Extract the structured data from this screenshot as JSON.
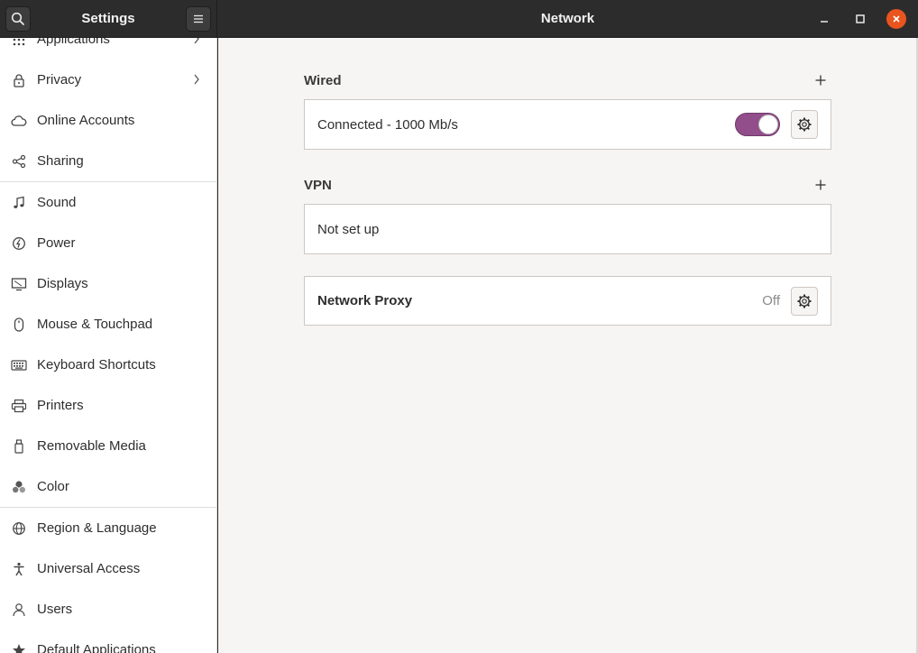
{
  "header": {
    "sidebar_title": "Settings",
    "page_title": "Network"
  },
  "sidebar": {
    "items": [
      {
        "label": "Applications",
        "icon": "apps-icon",
        "chevron": true
      },
      {
        "label": "Privacy",
        "icon": "lock-icon",
        "chevron": true
      },
      {
        "label": "Online Accounts",
        "icon": "cloud-icon"
      },
      {
        "label": "Sharing",
        "icon": "share-icon"
      },
      {
        "label": "Sound",
        "icon": "music-note-icon"
      },
      {
        "label": "Power",
        "icon": "power-icon"
      },
      {
        "label": "Displays",
        "icon": "display-icon"
      },
      {
        "label": "Mouse & Touchpad",
        "icon": "mouse-icon"
      },
      {
        "label": "Keyboard Shortcuts",
        "icon": "keyboard-icon"
      },
      {
        "label": "Printers",
        "icon": "printer-icon"
      },
      {
        "label": "Removable Media",
        "icon": "usb-icon"
      },
      {
        "label": "Color",
        "icon": "color-icon"
      },
      {
        "label": "Region & Language",
        "icon": "globe-icon"
      },
      {
        "label": "Universal Access",
        "icon": "accessibility-icon"
      },
      {
        "label": "Users",
        "icon": "user-icon"
      },
      {
        "label": "Default Applications",
        "icon": "star-icon"
      }
    ]
  },
  "main": {
    "wired": {
      "title": "Wired",
      "status": "Connected - 1000 Mb/s",
      "enabled": true
    },
    "vpn": {
      "title": "VPN",
      "status": "Not set up"
    },
    "proxy": {
      "label": "Network Proxy",
      "status": "Off"
    }
  },
  "colors": {
    "accent": "#924d8b",
    "close": "#e9541f",
    "header": "#2c2c2c"
  }
}
